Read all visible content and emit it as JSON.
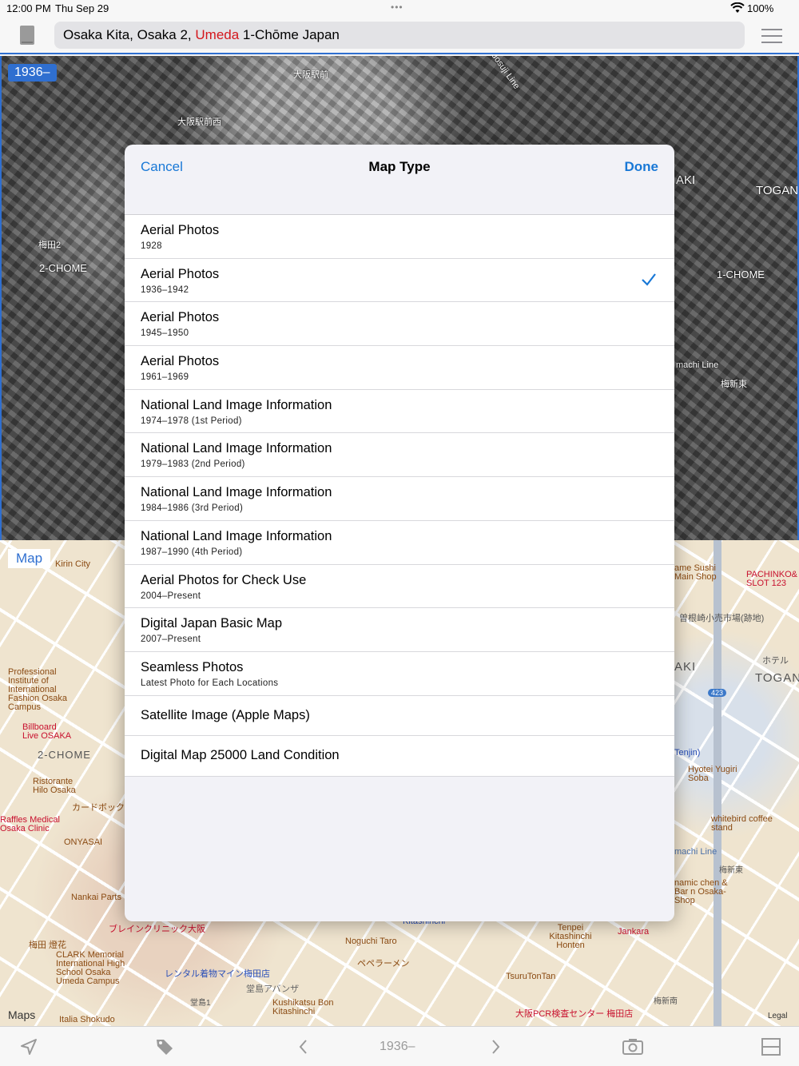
{
  "status_bar": {
    "time": "12:00 PM",
    "date": "Thu Sep 29",
    "battery": "100%"
  },
  "header": {
    "address_prefix": "Osaka Kita, Osaka 2,",
    "address_highlight": "Umeda",
    "address_suffix": "1-Chōme Japan",
    "highlight_color": "#d4161c"
  },
  "aerial_map": {
    "period_badge": "1936–",
    "labels": [
      "大阪駅前",
      "大阪駅前西",
      "梅田2",
      "2-CHOME",
      "1-CHOME",
      "TOGAN",
      "AKI",
      "梅新東",
      "Midosuji Line",
      "machi Line"
    ]
  },
  "street_map": {
    "badge": "Map",
    "labels": {
      "kirin": "Kirin City",
      "professional": "Professional Institute of International Fashion Osaka Campus",
      "billboard": "Billboard Live OSAKA",
      "chome2": "2-CHOME",
      "ristorante": "Ristorante Hilo Osaka",
      "card": "カードボック",
      "raffles": "Raffles Medical Osaka Clinic",
      "onyasai": "ONYASAI",
      "nankai": "Nankai Parts",
      "brain": "ブレインクリニック大阪",
      "umeda_tomoka": "梅田 燈花",
      "clark": "CLARK Memorial International High School Osaka Umeda Campus",
      "italia": "Italia Shokudo",
      "rental": "レンタル着物マイン梅田店",
      "dojima": "堂島アバンザ",
      "dojima1": "堂島1",
      "kushikatsu": "Kushikatsu Bon Kitashinchi",
      "noguchi": "Noguchi Taro",
      "pepper": "ペペラーメン",
      "tsuru": "TsuruTonTan",
      "pcr": "大阪PCR検査センター 梅田店",
      "tenpei": "Tenpei Kitashinchi Honten",
      "jankara": "Jankara",
      "sushi": "ame Sushi Main Shop",
      "pachinko": "PACHINKO& SLOT 123",
      "sonezaki": "曽根崎小売市場(跡地)",
      "hotel": "ホテル",
      "togan": "TOGAN",
      "aki": "AKI",
      "tenjin": "Tenjin)",
      "hyotei": "Hyotei Yugiri Soba",
      "whitebird": "whitebird coffee stand",
      "kitashinchi": "Kitashinchi",
      "dynamic": "namic chen & Bar n Osaka-Shop",
      "umeshinminami": "梅新南",
      "umeshinhigashi": "梅新東",
      "machi": "machi Line",
      "route": "423"
    },
    "maps_logo": "Maps",
    "legal": "Legal"
  },
  "modal": {
    "title": "Map Type",
    "cancel_label": "Cancel",
    "done_label": "Done",
    "selected_index": 1,
    "options": [
      {
        "title": "Aerial Photos",
        "subtitle": "1928"
      },
      {
        "title": "Aerial Photos",
        "subtitle": "1936–1942"
      },
      {
        "title": "Aerial Photos",
        "subtitle": "1945–1950"
      },
      {
        "title": "Aerial Photos",
        "subtitle": "1961–1969"
      },
      {
        "title": "National Land Image Information",
        "subtitle": "1974–1978 (1st Period)"
      },
      {
        "title": "National Land Image Information",
        "subtitle": "1979–1983 (2nd Period)"
      },
      {
        "title": "National Land Image Information",
        "subtitle": "1984–1986 (3rd Period)"
      },
      {
        "title": "National Land Image Information",
        "subtitle": "1987–1990 (4th Period)"
      },
      {
        "title": "Aerial Photos for Check Use",
        "subtitle": "2004–Present"
      },
      {
        "title": "Digital Japan Basic Map",
        "subtitle": "2007–Present"
      },
      {
        "title": "Seamless Photos",
        "subtitle": "Latest Photo for Each Locations"
      },
      {
        "title": "Satellite Image (Apple Maps)",
        "subtitle": ""
      },
      {
        "title": "Digital Map 25000 Land Condition",
        "subtitle": ""
      }
    ]
  },
  "toolbar": {
    "period_title": "1936–",
    "icons": [
      "location-arrow-icon",
      "tag-icon",
      "chevron-left-icon",
      "chevron-right-icon",
      "camera-icon",
      "split-view-icon"
    ]
  },
  "colors": {
    "accent": "#1978d6",
    "map_border": "#2f6fd0"
  }
}
